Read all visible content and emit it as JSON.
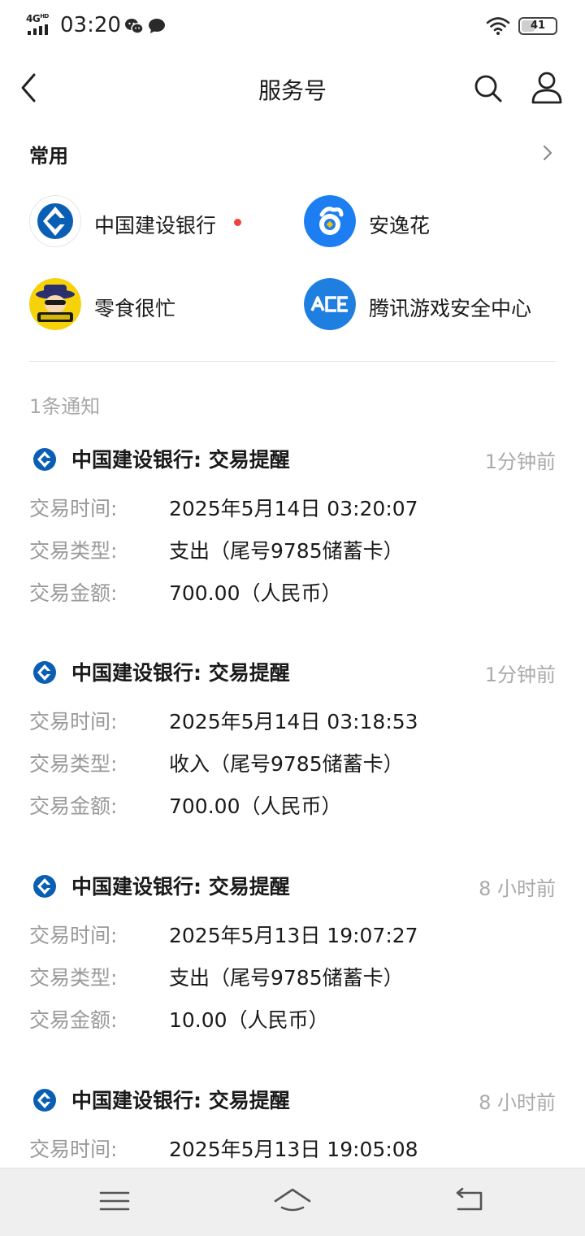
{
  "status_bar": {
    "network": "4G",
    "network_sup": "HD",
    "time": "03:20",
    "battery": "41",
    "battery_level": 0.41,
    "icons": [
      "signal-icon",
      "wechat-icon",
      "chat-bubble-icon",
      "wifi-icon",
      "battery-icon"
    ]
  },
  "header": {
    "title": "服务号",
    "icons": [
      "back-arrow-icon",
      "search-icon",
      "profile-icon"
    ]
  },
  "frequent": {
    "title": "常用",
    "more_icon": "chevron-right-icon",
    "accounts": [
      {
        "name": "中国建设银行",
        "has_unread": true,
        "avatar": "ccb-logo",
        "accent": "#0a5fb4"
      },
      {
        "name": "安逸花",
        "has_unread": false,
        "avatar": "anyihua-logo",
        "accent": "#1c7ef1"
      },
      {
        "name": "零食很忙",
        "has_unread": false,
        "avatar": "lingshihenmang-logo",
        "accent": "#f6d20a"
      },
      {
        "name": "腾讯游戏安全中心",
        "has_unread": false,
        "avatar": "ace-logo",
        "accent": "#1e7fe0"
      }
    ]
  },
  "notifications": {
    "count_label": "1条通知",
    "messages": [
      {
        "title": "中国建设银行: 交易提醒",
        "time": "1分钟前",
        "rows": [
          {
            "label": "交易时间:",
            "value": "2025年5月14日 03:20:07"
          },
          {
            "label": "交易类型:",
            "value": "支出（尾号9785储蓄卡）"
          },
          {
            "label": "交易金额:",
            "value": "700.00（人民币）"
          }
        ]
      },
      {
        "title": "中国建设银行: 交易提醒",
        "time": "1分钟前",
        "rows": [
          {
            "label": "交易时间:",
            "value": "2025年5月14日 03:18:53"
          },
          {
            "label": "交易类型:",
            "value": "收入（尾号9785储蓄卡）"
          },
          {
            "label": "交易金额:",
            "value": "700.00（人民币）"
          }
        ]
      },
      {
        "title": "中国建设银行: 交易提醒",
        "time": "8 小时前",
        "rows": [
          {
            "label": "交易时间:",
            "value": "2025年5月13日 19:07:27"
          },
          {
            "label": "交易类型:",
            "value": "支出（尾号9785储蓄卡）"
          },
          {
            "label": "交易金额:",
            "value": "10.00（人民币）"
          }
        ]
      },
      {
        "title": "中国建设银行: 交易提醒",
        "time": "8 小时前",
        "rows": [
          {
            "label": "交易时间:",
            "value": "2025年5月13日 19:05:08"
          }
        ]
      }
    ]
  },
  "navbar": {
    "icons": [
      "menu-icon",
      "home-icon",
      "back-icon"
    ]
  },
  "colors": {
    "ccb_blue": "#0a5fb4",
    "unread_dot": "#f04141",
    "muted_text": "#9a9a9a",
    "time_text": "#aaaaaa",
    "nav_bg": "#efefef"
  }
}
